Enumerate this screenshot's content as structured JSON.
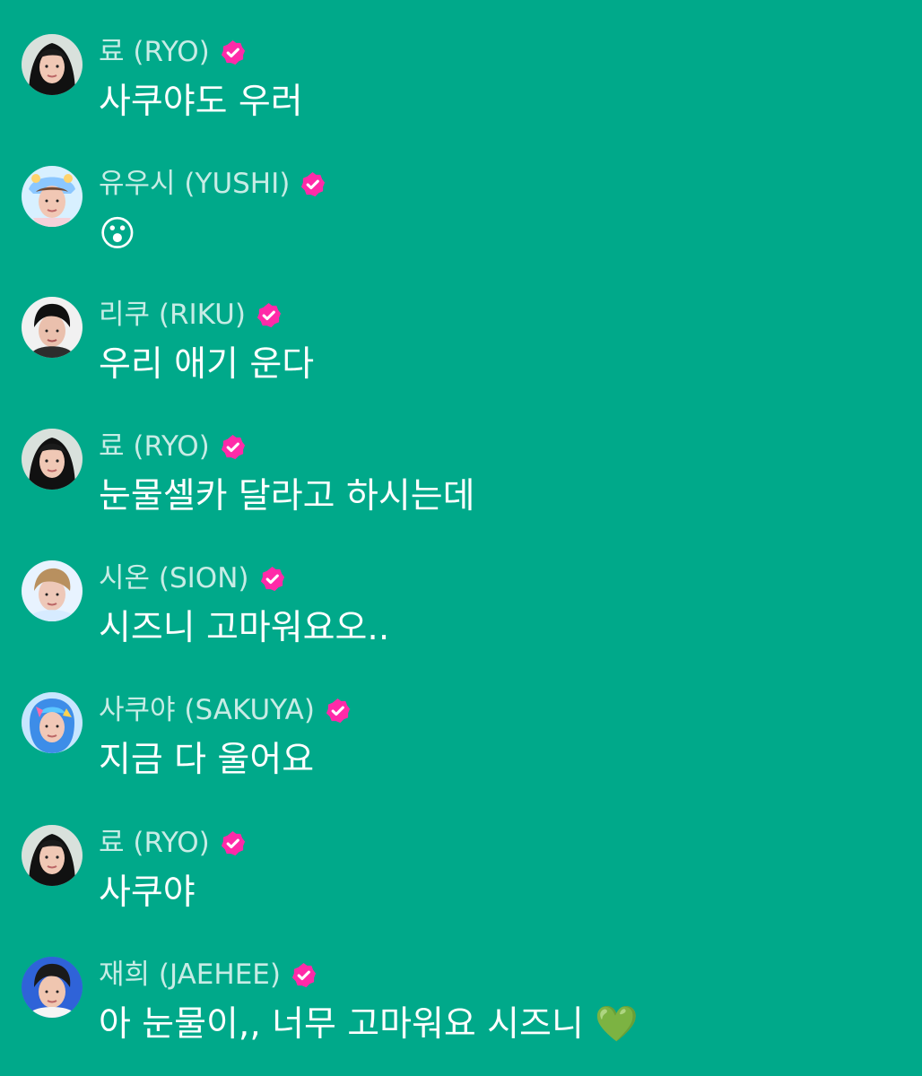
{
  "colors": {
    "background": "#00a98a",
    "username": "rgba(255,255,255,0.78)",
    "message": "#ffffff",
    "verified": "#ff2aa8"
  },
  "messages": [
    {
      "username": "료 (RYO)",
      "text": "사쿠야도 우러",
      "avatar": "portrait-hood-avatar",
      "verified": true
    },
    {
      "username": "유우시 (YUSHI)",
      "text": "😮",
      "avatar": "portrait-pastel-hat-avatar",
      "verified": true
    },
    {
      "username": "리쿠 (RIKU)",
      "text": "우리 애기 운다",
      "avatar": "portrait-dark-hair-avatar",
      "verified": true
    },
    {
      "username": "료 (RYO)",
      "text": "눈물셀카 달라고 하시는데",
      "avatar": "portrait-hood-avatar",
      "verified": true
    },
    {
      "username": "시온 (SION)",
      "text": "시즈니 고마워요오..",
      "avatar": "portrait-light-hair-avatar",
      "verified": true
    },
    {
      "username": "사쿠야 (SAKUYA)",
      "text": "지금 다 울어요",
      "avatar": "portrait-blue-scarf-avatar",
      "verified": true
    },
    {
      "username": "료 (RYO)",
      "text": "사쿠야",
      "avatar": "portrait-hood-avatar",
      "verified": true
    },
    {
      "username": "재희 (JAEHEE)",
      "text": "아 눈물이,, 너무 고마워요 시즈니 💚",
      "avatar": "portrait-blue-wall-avatar",
      "verified": true
    }
  ]
}
